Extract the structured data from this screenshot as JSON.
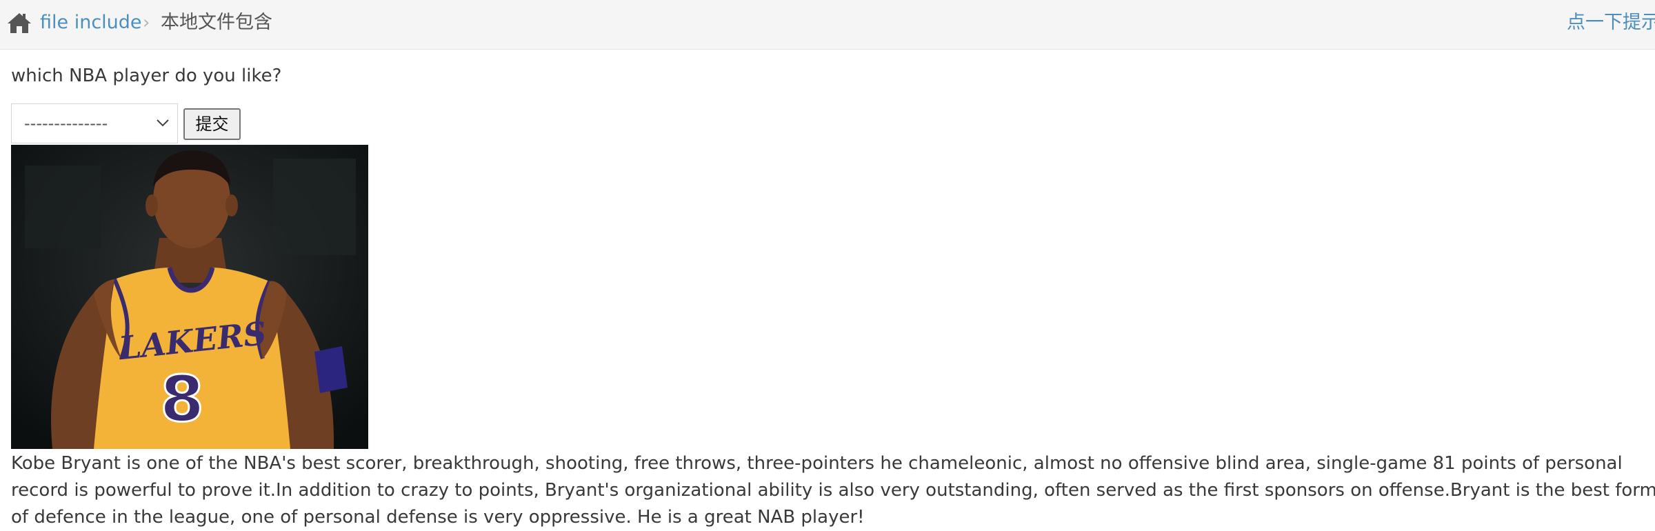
{
  "breadcrumb": {
    "home_icon": "home-icon",
    "link_label": "file include",
    "separator": "›",
    "active_label": "本地文件包含"
  },
  "hint": {
    "label": "点一下提示"
  },
  "form": {
    "question": "which NBA player do you like?",
    "select_value": "--------------",
    "submit_label": "提交"
  },
  "player": {
    "image_subject": "Kobe Bryant in Lakers #8 jersey",
    "jersey_lettering": "LAKERS",
    "jersey_number": "8",
    "description": "Kobe Bryant is one of the NBA's best scorer, breakthrough, shooting, free throws, three-pointers he chameleonic, almost no offensive blind area, single-game 81 points of personal record is powerful to prove it.In addition to crazy to points, Bryant's organizational ability is also very outstanding, often served as the first sponsors on offense.Bryant is the best form of defence in the league, one of personal defense is very oppressive. He is a great NAB player!"
  },
  "colors": {
    "link": "#4c8fbd",
    "breadcrumb_bg": "#f5f5f5",
    "text": "#393939",
    "jersey_gold": "#f2b338",
    "jersey_purple": "#3a2a6e"
  }
}
